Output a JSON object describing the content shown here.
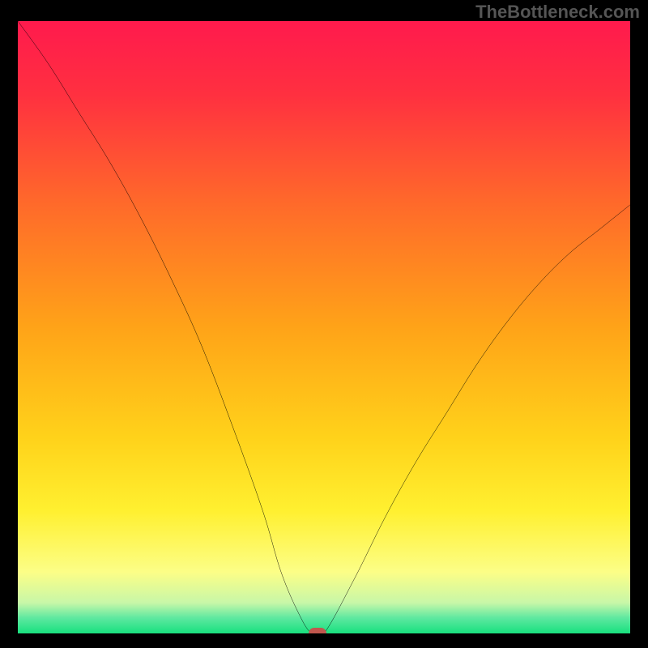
{
  "watermark": "TheBottleneck.com",
  "chart_data": {
    "type": "line",
    "title": "",
    "xlabel": "",
    "ylabel": "",
    "xlim": [
      0,
      100
    ],
    "ylim": [
      0,
      100
    ],
    "x": [
      0,
      5,
      10,
      15,
      20,
      25,
      30,
      35,
      40,
      43,
      46,
      48,
      50,
      55,
      60,
      65,
      70,
      75,
      80,
      85,
      90,
      95,
      100
    ],
    "y": [
      100,
      93,
      85,
      77,
      68,
      58,
      47,
      34,
      20,
      10,
      3,
      0,
      0,
      9,
      19,
      28,
      36,
      44,
      51,
      57,
      62,
      66,
      70
    ],
    "marker": {
      "x": 49,
      "y": 0
    },
    "gradient_stops": [
      {
        "pos": 0.0,
        "color": "#ff1a4d"
      },
      {
        "pos": 0.12,
        "color": "#ff3040"
      },
      {
        "pos": 0.3,
        "color": "#ff6a2a"
      },
      {
        "pos": 0.5,
        "color": "#ffa318"
      },
      {
        "pos": 0.68,
        "color": "#ffd21a"
      },
      {
        "pos": 0.8,
        "color": "#fff030"
      },
      {
        "pos": 0.9,
        "color": "#fcfe87"
      },
      {
        "pos": 0.95,
        "color": "#c8f7a8"
      },
      {
        "pos": 0.975,
        "color": "#5de8a0"
      },
      {
        "pos": 1.0,
        "color": "#18e07e"
      }
    ]
  }
}
